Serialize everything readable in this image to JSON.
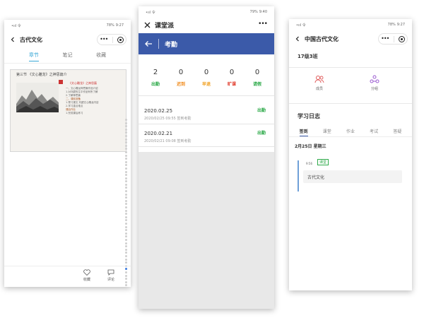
{
  "colors": {
    "accent": "#39a7d6",
    "banner": "#3b5aa9",
    "present": "#2eaa4a",
    "late": "#f08a1a",
    "early_leave": "#f0a020",
    "absent": "#e03a2a",
    "leave": "#2eaa4a"
  },
  "phone1": {
    "status_left": "•ııl 令",
    "status_battery": "78%",
    "status_time": "9:27",
    "nav_title": "古代文化",
    "tabs": [
      "章节",
      "笔记",
      "收藏"
    ],
    "active_tab": 0,
    "article": {
      "title": "第三节 《文心雕龙》之神思篇介",
      "heading": "《文心雕龙》之神思篇",
      "lines": [
        "一、文心雕龙神思篇作品介绍",
        "1.对刘勰的生平作品有所了解",
        "2.了解神思篇",
        "二、课前准备",
        "1.预习课文 刘勰文心雕龙内容",
        "2.学习重点难点",
        "课后作业",
        "1.完成课后练习"
      ]
    },
    "dots_count": 64,
    "active_dot": 46,
    "bottom": {
      "favorite": "收藏",
      "comment": "评论"
    }
  },
  "phone2": {
    "status_left": "•ııl 令",
    "status_battery": "79%",
    "status_time": "9:40",
    "nav_title": "课堂派",
    "banner_title": "考勤",
    "stats": [
      {
        "num": "2",
        "label": "出勤",
        "color": "#2eaa4a"
      },
      {
        "num": "0",
        "label": "迟到",
        "color": "#f08a1a"
      },
      {
        "num": "0",
        "label": "早退",
        "color": "#f0a020"
      },
      {
        "num": "0",
        "label": "旷课",
        "color": "#e03a2a"
      },
      {
        "num": "0",
        "label": "请假",
        "color": "#2eaa4a"
      }
    ],
    "records": [
      {
        "date": "2020.02.25",
        "sub": "2020/02/25 09:55 签到考勤",
        "status": "出勤"
      },
      {
        "date": "2020.02.21",
        "sub": "2020/02/21 09:08 签到考勤",
        "status": "出勤"
      }
    ]
  },
  "phone3": {
    "status_left": "•ııl 令",
    "status_battery": "78%",
    "status_time": "9:27",
    "nav_title": "中国古代文化",
    "class_name": "17级3班",
    "icons": [
      {
        "label": "成员",
        "icon": "users-icon"
      },
      {
        "label": "分组",
        "icon": "group-icon"
      }
    ],
    "section_title": "学习日志",
    "tabs": [
      "签到",
      "课堂",
      "作业",
      "考试",
      "答疑"
    ],
    "active_tab": 0,
    "date": "2月25日 星期三",
    "time": "9:56",
    "tag": "课堂",
    "card_text": "古代文化"
  }
}
